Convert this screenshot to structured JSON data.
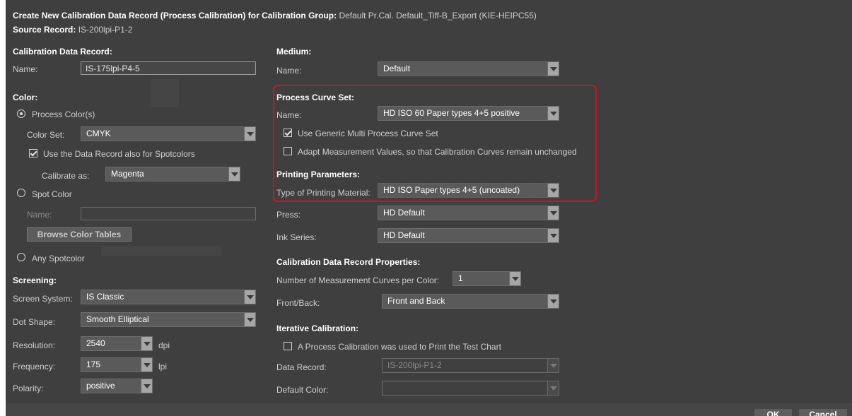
{
  "header": {
    "title_prefix": "Create New Calibration Data Record (Process Calibration) for Calibration Group:",
    "group_name": "Default Pr.Cal. Default_Tiff-B_Export (KIE-HEIPC55)",
    "source_label": "Source Record:",
    "source_value": "IS-200lpi-P1-2"
  },
  "record": {
    "heading": "Calibration Data Record:",
    "name_label": "Name:",
    "name_value": "IS-175lpi-P4-5"
  },
  "color": {
    "heading": "Color:",
    "process_label": "Process Color(s)",
    "color_set_label": "Color Set:",
    "color_set_value": "CMYK",
    "use_spot_label": "Use the Data Record also for Spotcolors",
    "calibrate_label": "Calibrate as:",
    "calibrate_value": "Magenta",
    "spot_label": "Spot Color",
    "spot_name_label": "Name:",
    "browse_label": "Browse Color Tables",
    "any_spot_label": "Any Spotcolor"
  },
  "screening": {
    "heading": "Screening:",
    "system_label": "Screen System:",
    "system_value": "IS Classic",
    "dot_label": "Dot Shape:",
    "dot_value": "Smooth Elliptical",
    "res_label": "Resolution:",
    "res_value": "2540",
    "res_unit": "dpi",
    "freq_label": "Frequency:",
    "freq_value": "175",
    "freq_unit": "lpi",
    "pol_label": "Polarity:",
    "pol_value": "positive"
  },
  "medium": {
    "heading": "Medium:",
    "name_label": "Name:",
    "name_value": "Default"
  },
  "curve_set": {
    "heading": "Process Curve Set:",
    "name_label": "Name:",
    "name_value": "HD ISO 60 Paper types 4+5 positive",
    "generic_label": "Use Generic Multi Process Curve Set",
    "adapt_label": "Adapt Measurement Values, so that Calibration Curves remain unchanged"
  },
  "printing": {
    "heading": "Printing Parameters:",
    "material_label": "Type of Printing Material:",
    "material_value": "HD ISO Paper types 4+5 (uncoated)",
    "press_label": "Press:",
    "press_value": "HD Default",
    "ink_label": "Ink Series:",
    "ink_value": "HD Default"
  },
  "properties": {
    "heading": "Calibration Data Record Properties:",
    "curves_label": "Number of Measurement Curves per Color:",
    "curves_value": "1",
    "front_label": "Front/Back:",
    "front_value": "Front and Back"
  },
  "iterative": {
    "heading": "Iterative Calibration:",
    "process_used_label": "A Process Calibration was used to Print the Test Chart",
    "record_label": "Data Record:",
    "record_value": "IS-200lpi-P1-2",
    "default_color_label": "Default Color:",
    "default_color_value": ""
  },
  "footer": {
    "ok_label": "OK",
    "cancel_label": "Cancel"
  },
  "colors": {
    "highlight": "#d0141c",
    "background": "#3f3f3f"
  }
}
